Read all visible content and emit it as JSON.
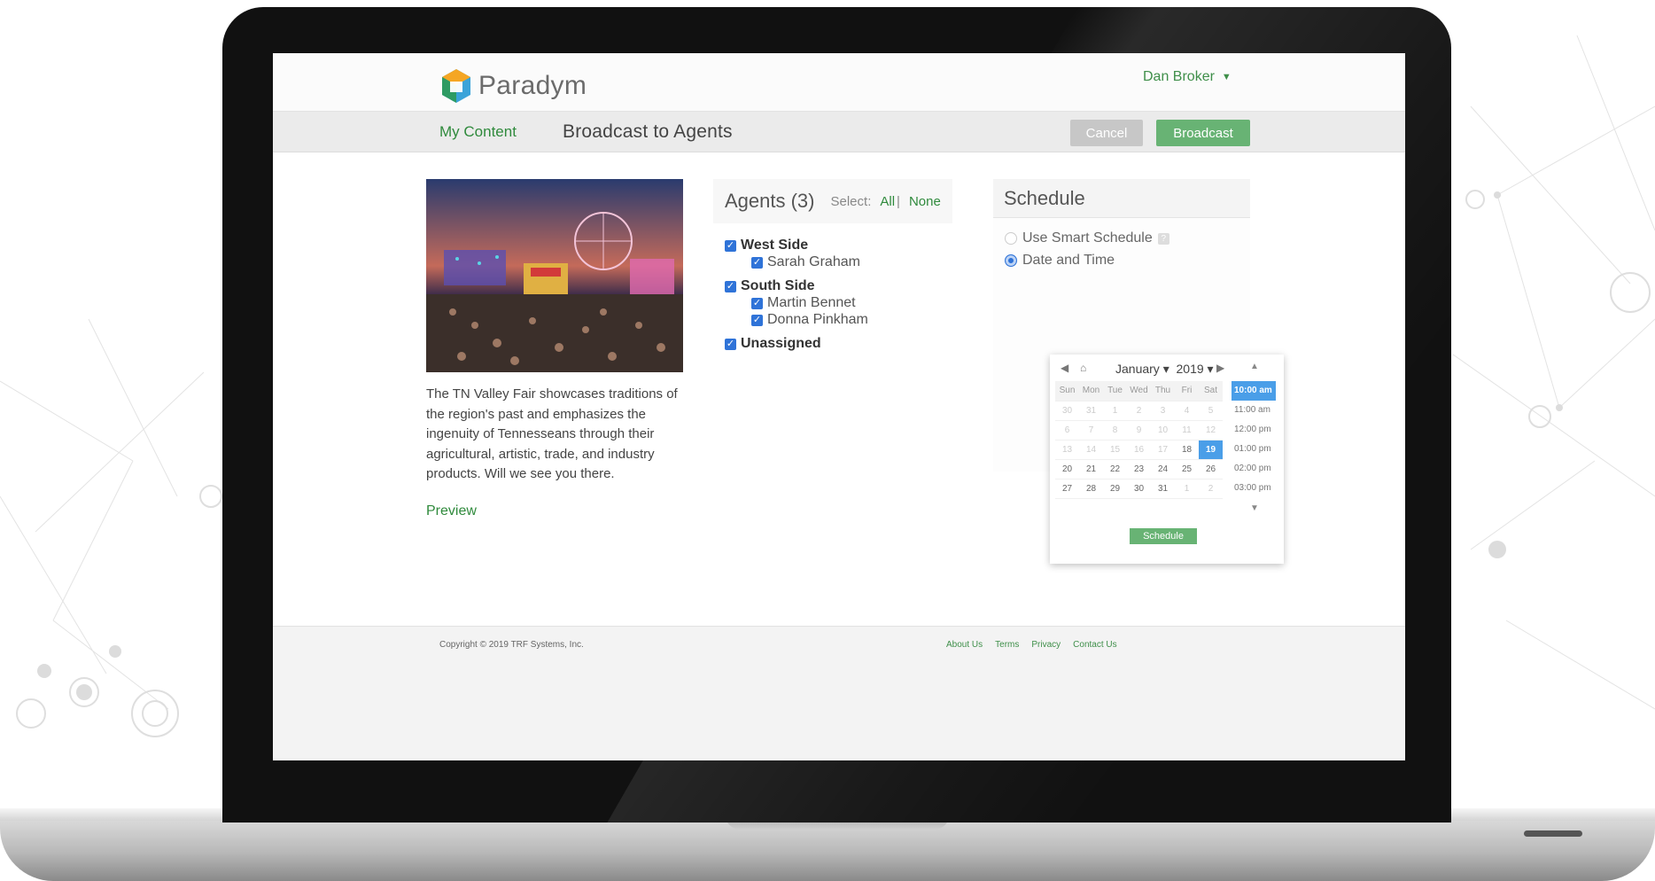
{
  "app": {
    "brand": "Paradym",
    "user_name": "Dan Broker"
  },
  "subnav": {
    "my_content": "My Content",
    "page_title": "Broadcast to Agents",
    "cancel_label": "Cancel",
    "broadcast_label": "Broadcast"
  },
  "content": {
    "description": "The TN Valley Fair showcases traditions of the region's past and emphasizes the ingenuity of Tennesseans through their agricultural, artistic, trade, and industry products. Will we see you there.",
    "preview_label": "Preview"
  },
  "agents": {
    "title": "Agents (3)",
    "select_label": "Select:",
    "all_label": "All",
    "separator": "|",
    "none_label": "None",
    "groups": [
      {
        "label": "West Side",
        "checked": true,
        "members": [
          {
            "label": "Sarah Graham",
            "checked": true
          }
        ]
      },
      {
        "label": "South Side",
        "checked": true,
        "members": [
          {
            "label": "Martin Bennet",
            "checked": true
          },
          {
            "label": "Donna Pinkham",
            "checked": true
          }
        ]
      },
      {
        "label": "Unassigned",
        "checked": true,
        "members": []
      }
    ]
  },
  "schedule": {
    "title": "Schedule",
    "smart_label": "Use Smart Schedule",
    "smart_help_icon": "question-icon",
    "date_time_label": "Date and Time",
    "month": "January",
    "year": "2019",
    "weekdays": [
      "Sun",
      "Mon",
      "Tue",
      "Wed",
      "Thu",
      "Fri",
      "Sat"
    ],
    "weeks": [
      [
        "30",
        "31",
        "1",
        "2",
        "3",
        "4",
        "5"
      ],
      [
        "6",
        "7",
        "8",
        "9",
        "10",
        "11",
        "12"
      ],
      [
        "13",
        "14",
        "15",
        "16",
        "17",
        "18",
        "19"
      ],
      [
        "20",
        "21",
        "22",
        "23",
        "24",
        "25",
        "26"
      ],
      [
        "27",
        "28",
        "29",
        "30",
        "31",
        "1",
        "2"
      ]
    ],
    "selected_day": "19",
    "times": [
      "10:00 am",
      "11:00 am",
      "12:00 pm",
      "01:00 pm",
      "02:00 pm",
      "03:00 pm"
    ],
    "selected_time": "10:00 am",
    "schedule_button": "Schedule"
  },
  "footer": {
    "copyright": "Copyright © 2019 TRF Systems, Inc.",
    "links": [
      "About Us",
      "Terms",
      "Privacy",
      "Contact Us"
    ]
  },
  "colors": {
    "accent_green": "#68b374",
    "link_green": "#2f8a3c",
    "checkbox_blue": "#2f73d8",
    "selected_blue": "#4a9ee8"
  }
}
